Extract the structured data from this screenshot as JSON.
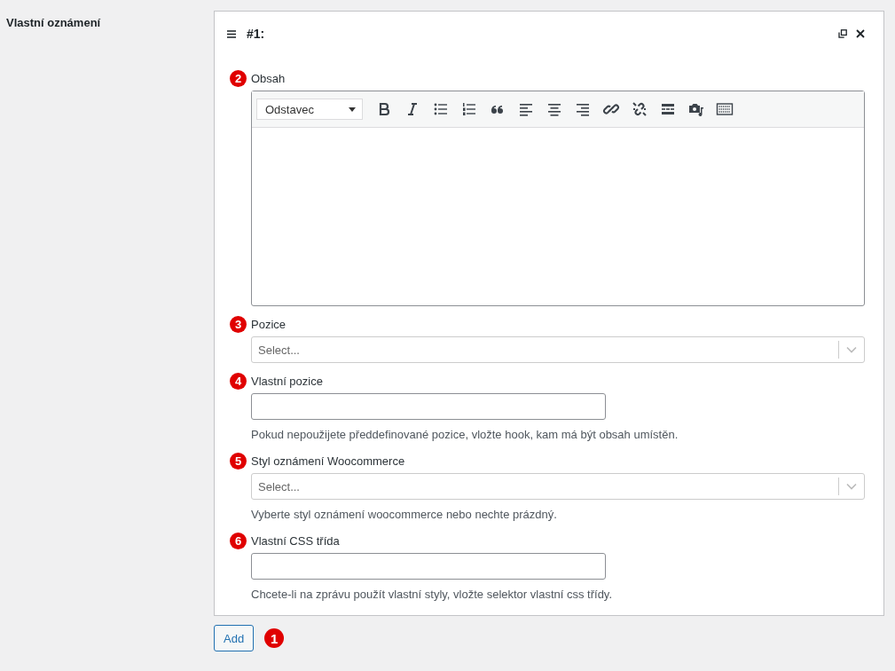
{
  "section_label": "Vlastní oznámení",
  "panel": {
    "title": "#1:",
    "fields": [
      {
        "kind": "editor",
        "badge": "2",
        "label": "Obsah",
        "format": "Odstavec"
      },
      {
        "kind": "select",
        "badge": "3",
        "label": "Pozice",
        "placeholder": "Select..."
      },
      {
        "kind": "text",
        "badge": "4",
        "label": "Vlastní pozice",
        "help": "Pokud nepoužijete předdefinované pozice, vložte hook, kam má být obsah umístěn."
      },
      {
        "kind": "select",
        "badge": "5",
        "label": "Styl oznámení Woocommerce",
        "placeholder": "Select...",
        "help": "Vyberte styl oznámení woocommerce nebo nechte prázdný."
      },
      {
        "kind": "text",
        "badge": "6",
        "label": "Vlastní CSS třída",
        "help": "Chcete-li na zprávu použít vlastní styly, vložte selektor vlastní css třídy."
      }
    ]
  },
  "add_button": {
    "label": "Add",
    "badge": "1"
  }
}
